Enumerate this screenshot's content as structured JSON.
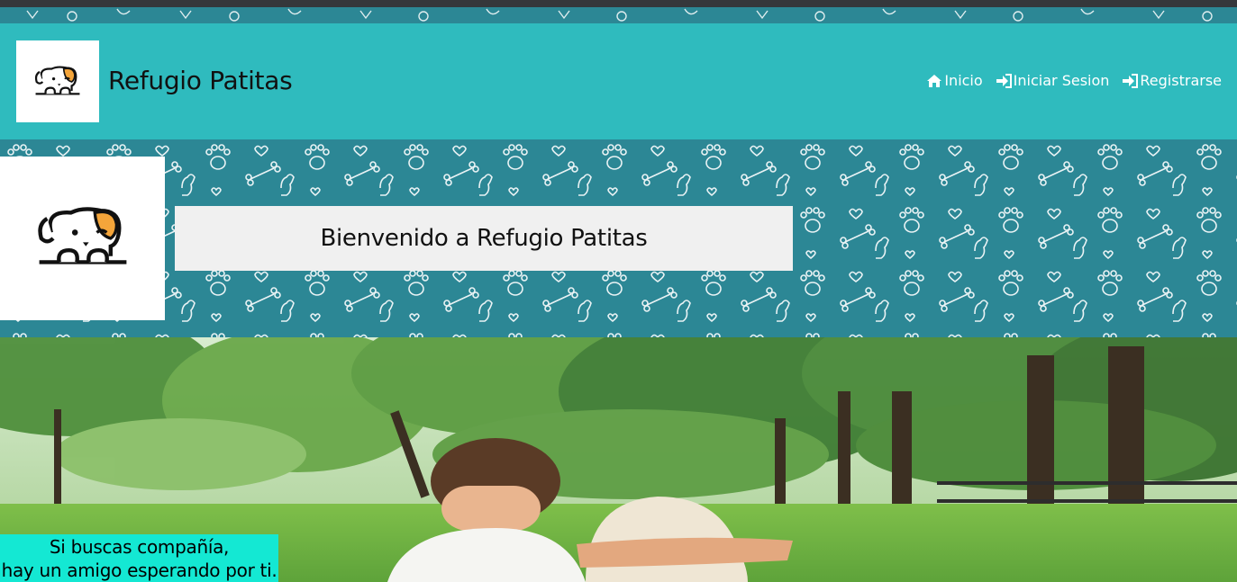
{
  "brand": {
    "name": "Refugio Patitas",
    "logo_icon": "puppy-logo-icon"
  },
  "nav": {
    "items": [
      {
        "label": "Inicio",
        "icon": "home-icon"
      },
      {
        "label": "Iniciar Sesion",
        "icon": "sign-in-icon"
      },
      {
        "label": "Registrarse",
        "icon": "sign-in-icon"
      }
    ]
  },
  "hero": {
    "title": "Bienvenido a Refugio Patitas",
    "logo_icon": "puppy-logo-icon"
  },
  "banner": {
    "tagline_line1": "Si buscas compañía,",
    "tagline_line2": "hay un amigo esperando por ti."
  },
  "colors": {
    "navbar": "#2fbbbe",
    "pattern": "#2c8795",
    "tagline_bg": "#14e8d3",
    "welcome_bg": "#f0f0f0",
    "logo_orange": "#f4a53a"
  }
}
